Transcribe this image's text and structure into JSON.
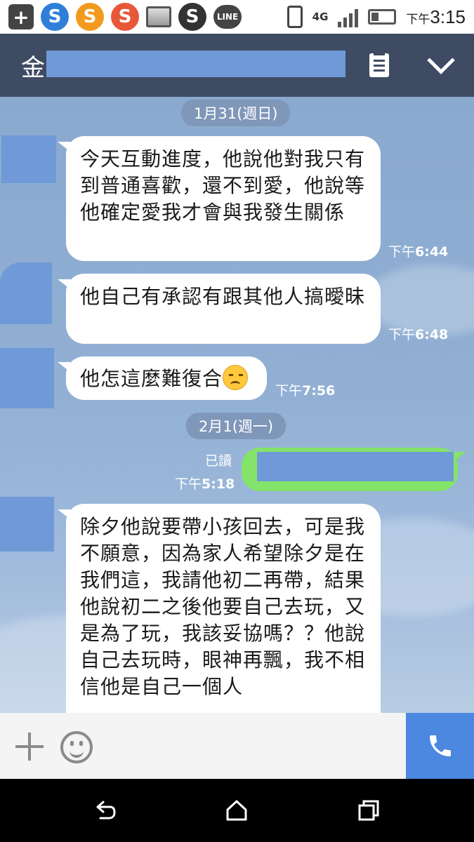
{
  "status_bar": {
    "time_prefix": "下午",
    "time": "3:15",
    "network": "4G",
    "app_icons": [
      "add-icon",
      "s-app-blue-icon",
      "s-app-orange-icon",
      "s-app-red-icon",
      "gallery-icon",
      "skype-icon",
      "line-icon"
    ],
    "line_label": "LINE",
    "skype_label": "S",
    "s_label": "S"
  },
  "header": {
    "title_prefix": "金"
  },
  "messages": [
    {
      "type": "date",
      "text": "1月31(週日)"
    },
    {
      "type": "in",
      "text": "今天互動進度，他說他對我只有到普通喜歡，還不到愛，他說等他確定愛我才會與我發生關係",
      "time_prefix": "下午",
      "time": "6:44"
    },
    {
      "type": "in",
      "text": "他自己有承認有跟其他人搞曖昧",
      "time_prefix": "下午",
      "time": "6:48"
    },
    {
      "type": "in",
      "text": "他怎這麼難復合",
      "time_prefix": "下午",
      "time": "7:56"
    },
    {
      "type": "date",
      "text": "2月1(週一)"
    },
    {
      "type": "out",
      "read": "已讀",
      "time_prefix": "下午",
      "time": "5:18"
    },
    {
      "type": "in",
      "text": "除夕他說要帶小孩回去，可是我不願意，因為家人希望除夕是在我們這，我請他初二再帶，結果他說初二之後他要自己去玩，又是為了玩，我該妥協嗎？？他說自己去玩時，眼神再飄，我不相信他是自己一個人"
    }
  ],
  "colors": {
    "header_bg": "#3e4b63",
    "out_bubble": "#84e369",
    "call_button": "#4c87e0",
    "redaction": "#6f9ad7"
  }
}
